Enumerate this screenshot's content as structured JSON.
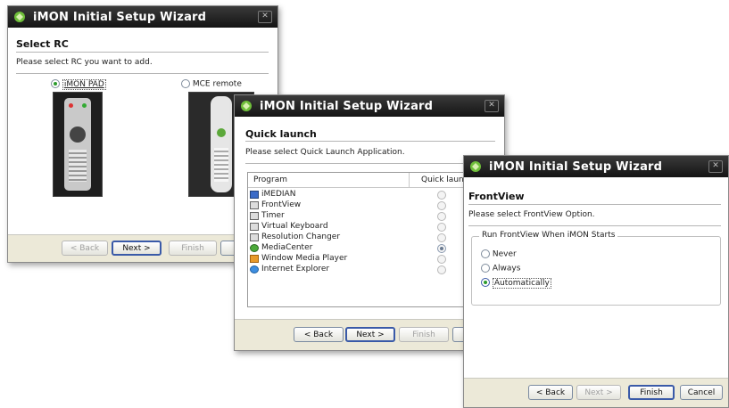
{
  "window1": {
    "title": "iMON Initial Setup Wizard",
    "heading": "Select RC",
    "subtitle": "Please select RC you want to add.",
    "options": [
      {
        "label": "iMON PAD",
        "selected": true
      },
      {
        "label": "MCE remote",
        "selected": false
      }
    ],
    "buttons": {
      "back": "< Back",
      "next": "Next >",
      "finish": "Finish"
    }
  },
  "window2": {
    "title": "iMON Initial Setup Wizard",
    "heading": "Quick launch",
    "subtitle": "Please select Quick Launch Application.",
    "columns": {
      "program": "Program",
      "quick_launch": "Quick launch"
    },
    "rows": [
      {
        "name": "iMEDIAN",
        "icon": "imedian-icon",
        "selected": false
      },
      {
        "name": "FrontView",
        "icon": "app-window-icon",
        "selected": false
      },
      {
        "name": "Timer",
        "icon": "app-window-icon",
        "selected": false
      },
      {
        "name": "Virtual Keyboard",
        "icon": "app-window-icon",
        "selected": false
      },
      {
        "name": "Resolution Changer",
        "icon": "app-window-icon",
        "selected": false
      },
      {
        "name": "MediaCenter",
        "icon": "media-center-icon",
        "selected": true
      },
      {
        "name": "Window Media Player",
        "icon": "media-player-icon",
        "selected": false
      },
      {
        "name": "Internet Explorer",
        "icon": "internet-explorer-icon",
        "selected": false
      }
    ],
    "buttons": {
      "back": "< Back",
      "next": "Next >",
      "finish": "Finish"
    }
  },
  "window3": {
    "title": "iMON Initial Setup Wizard",
    "heading": "FrontView",
    "subtitle": "Please select FrontView Option.",
    "group_label": "Run FrontView When iMON Starts",
    "options": [
      {
        "label": "Never",
        "selected": false
      },
      {
        "label": "Always",
        "selected": false
      },
      {
        "label": "Automatically",
        "selected": true
      }
    ],
    "buttons": {
      "back": "< Back",
      "next": "Next >",
      "finish": "Finish",
      "cancel": "Cancel"
    }
  }
}
